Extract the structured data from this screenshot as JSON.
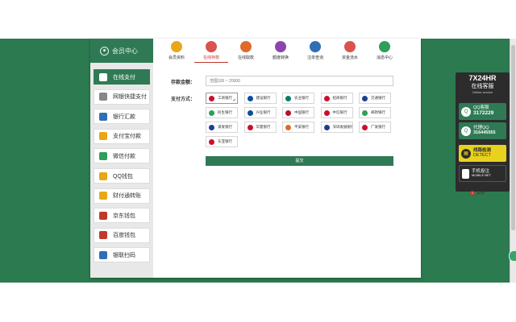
{
  "member_center": {
    "title": "会员中心",
    "icon": "user-circle-icon"
  },
  "nav": [
    {
      "label": "会员资料",
      "icon": "profile-icon",
      "color": "#e6a817"
    },
    {
      "label": "在线存款",
      "icon": "deposit-icon",
      "color": "#d9534f",
      "active": true
    },
    {
      "label": "在线取款",
      "icon": "withdraw-icon",
      "color": "#e06a2a"
    },
    {
      "label": "额度转换",
      "icon": "transfer-icon",
      "color": "#8e44ad"
    },
    {
      "label": "注单查询",
      "icon": "bet-query-icon",
      "color": "#2f6fb5"
    },
    {
      "label": "资金流水",
      "icon": "fund-flow-icon",
      "color": "#d9534f"
    },
    {
      "label": "消息中心",
      "icon": "message-icon",
      "color": "#2f9e5a"
    }
  ],
  "sidebar": [
    {
      "label": "在线支付",
      "icon": "card-icon",
      "active": true
    },
    {
      "label": "网银快捷支付",
      "icon": "ebank-icon"
    },
    {
      "label": "银行汇款",
      "icon": "bank-transfer-icon"
    },
    {
      "label": "支付宝付款",
      "icon": "alipay-icon"
    },
    {
      "label": "微信付款",
      "icon": "wechat-icon"
    },
    {
      "label": "QQ钱包",
      "icon": "qq-icon"
    },
    {
      "label": "财付通转账",
      "icon": "tenpay-icon"
    },
    {
      "label": "京东钱包",
      "icon": "jd-icon"
    },
    {
      "label": "百度钱包",
      "icon": "baidu-icon"
    },
    {
      "label": "银联扫码",
      "icon": "unionpay-scan-icon"
    }
  ],
  "form": {
    "amount_label": "存款金额：",
    "amount_placeholder": "范围100 ~ 20000",
    "method_label": "支付方式：",
    "submit_label": "提交"
  },
  "banks": [
    {
      "name": "工商银行",
      "color": "#c8102e",
      "selected": true
    },
    {
      "name": "建设银行",
      "color": "#0b4ea2"
    },
    {
      "name": "农业银行",
      "color": "#00806a"
    },
    {
      "name": "招商银行",
      "color": "#c8102e"
    },
    {
      "name": "交通银行",
      "color": "#1d3f8f"
    },
    {
      "name": "民生银行",
      "color": "#2f9e5a"
    },
    {
      "name": "兴业银行",
      "color": "#0b4ea2"
    },
    {
      "name": "中国银行",
      "color": "#b8102e"
    },
    {
      "name": "中信银行",
      "color": "#c8102e"
    },
    {
      "name": "邮政银行",
      "color": "#2f9e5a"
    },
    {
      "name": "浦发银行",
      "color": "#1d3f8f"
    },
    {
      "name": "华夏银行",
      "color": "#c8102e"
    },
    {
      "name": "平安银行",
      "color": "#e06a2a"
    },
    {
      "name": "深圳发展银行",
      "color": "#1d3f8f"
    },
    {
      "name": "广发银行",
      "color": "#c8102e"
    },
    {
      "name": "东亚银行",
      "color": "#c8102e"
    }
  ],
  "selected_check": "✔",
  "service": {
    "hours": "7X24HR",
    "title": "在线客服",
    "subtitle": "Online service",
    "qq_label": "QQ客服",
    "qq_number": "3172229",
    "agent_label": "代理QQ",
    "agent_number": "316445555",
    "detect_label": "线路检测",
    "detect_sub": "DETECT",
    "mobile_label": "手机投注",
    "mobile_sub": "MOBILE BET",
    "close_label": "关闭"
  }
}
